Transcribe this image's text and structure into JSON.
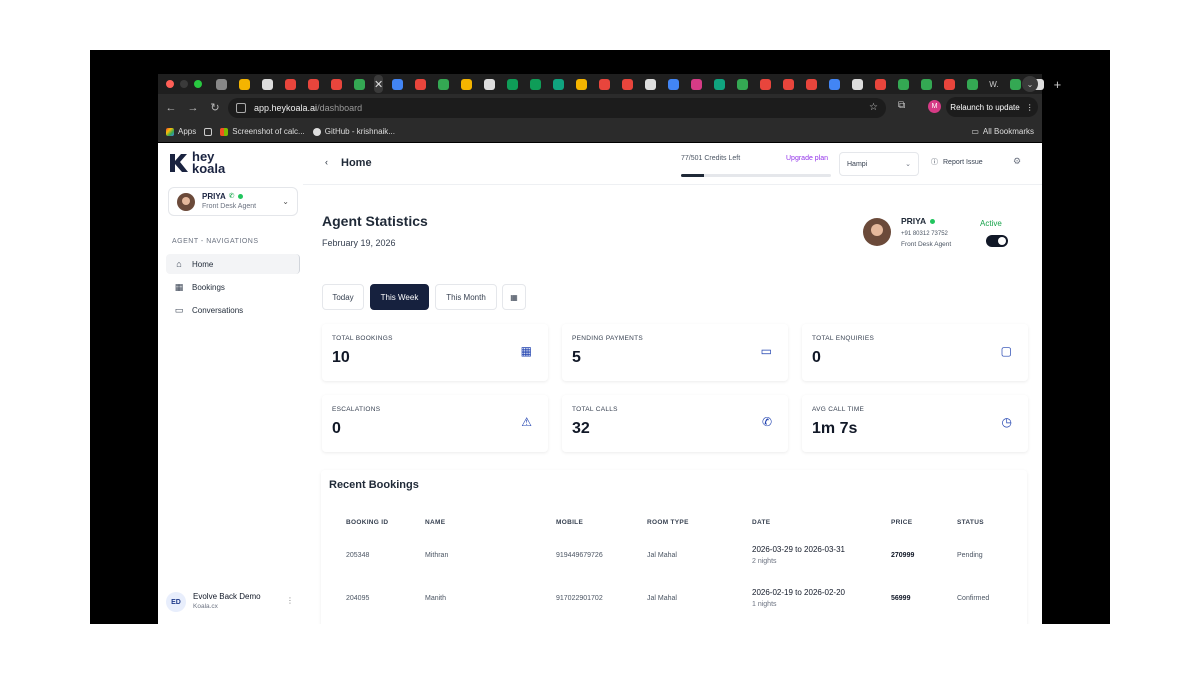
{
  "browser": {
    "url_host": "app.heykoala.ai",
    "url_path": "/dashboard",
    "relaunch_label": "Relaunch to update",
    "profile_initial": "M",
    "tab_text": "W.",
    "bookmarks": [
      {
        "label": "Apps"
      },
      {
        "label": "Screenshot of calc..."
      },
      {
        "label": "GitHub - krishnaik..."
      }
    ],
    "all_bookmarks": "All Bookmarks"
  },
  "sidebar": {
    "logo_text": "hey koala",
    "agent": {
      "name": "PRIYA",
      "role": "Front Desk Agent"
    },
    "nav_heading": "AGENT - NAVIGATIONS",
    "items": [
      {
        "label": "Home",
        "icon": "home-icon"
      },
      {
        "label": "Bookings",
        "icon": "calendar-icon"
      },
      {
        "label": "Conversations",
        "icon": "chat-icon"
      }
    ],
    "org": {
      "initials": "ED",
      "name": "Evolve Back Demo",
      "sub": "Koala.cx"
    }
  },
  "header": {
    "title": "Home",
    "credits": "77/501 Credits Left",
    "credits_used_fraction": 0.15,
    "upgrade_label": "Upgrade plan",
    "location": "Hampi",
    "report_label": "Report Issue"
  },
  "main": {
    "title": "Agent Statistics",
    "date": "February 19, 2026",
    "agent": {
      "name": "PRIYA",
      "phone": "+91 80312 73752",
      "role": "Front Desk Agent",
      "status": "Active"
    },
    "filters": [
      "Today",
      "This Week",
      "This Month"
    ],
    "selected_filter": "This Week",
    "stats": [
      {
        "label": "TOTAL BOOKINGS",
        "value": "10",
        "icon": "calendar-icon"
      },
      {
        "label": "PENDING PAYMENTS",
        "value": "5",
        "icon": "credit-card-icon"
      },
      {
        "label": "TOTAL ENQUIRIES",
        "value": "0",
        "icon": "message-icon"
      },
      {
        "label": "ESCALATIONS",
        "value": "0",
        "icon": "warning-icon"
      },
      {
        "label": "TOTAL CALLS",
        "value": "32",
        "icon": "phone-icon"
      },
      {
        "label": "AVG CALL TIME",
        "value": "1m 7s",
        "icon": "clock-icon"
      }
    ],
    "recent": {
      "title": "Recent Bookings",
      "columns": [
        "BOOKING ID",
        "NAME",
        "MOBILE",
        "ROOM TYPE",
        "DATE",
        "PRICE",
        "STATUS"
      ],
      "rows": [
        {
          "id": "205348",
          "name": "Mithran",
          "mobile": "919449679726",
          "room": "Jal Mahal",
          "date": "2026-03-29 to 2026-03-31",
          "nights": "2 nights",
          "price": "270999",
          "status": "Pending"
        },
        {
          "id": "204095",
          "name": "Manith",
          "mobile": "917022901702",
          "room": "Jal Mahal",
          "date": "2026-02-19 to 2026-02-20",
          "nights": "1 nights",
          "price": "56999",
          "status": "Confirmed"
        }
      ]
    }
  }
}
